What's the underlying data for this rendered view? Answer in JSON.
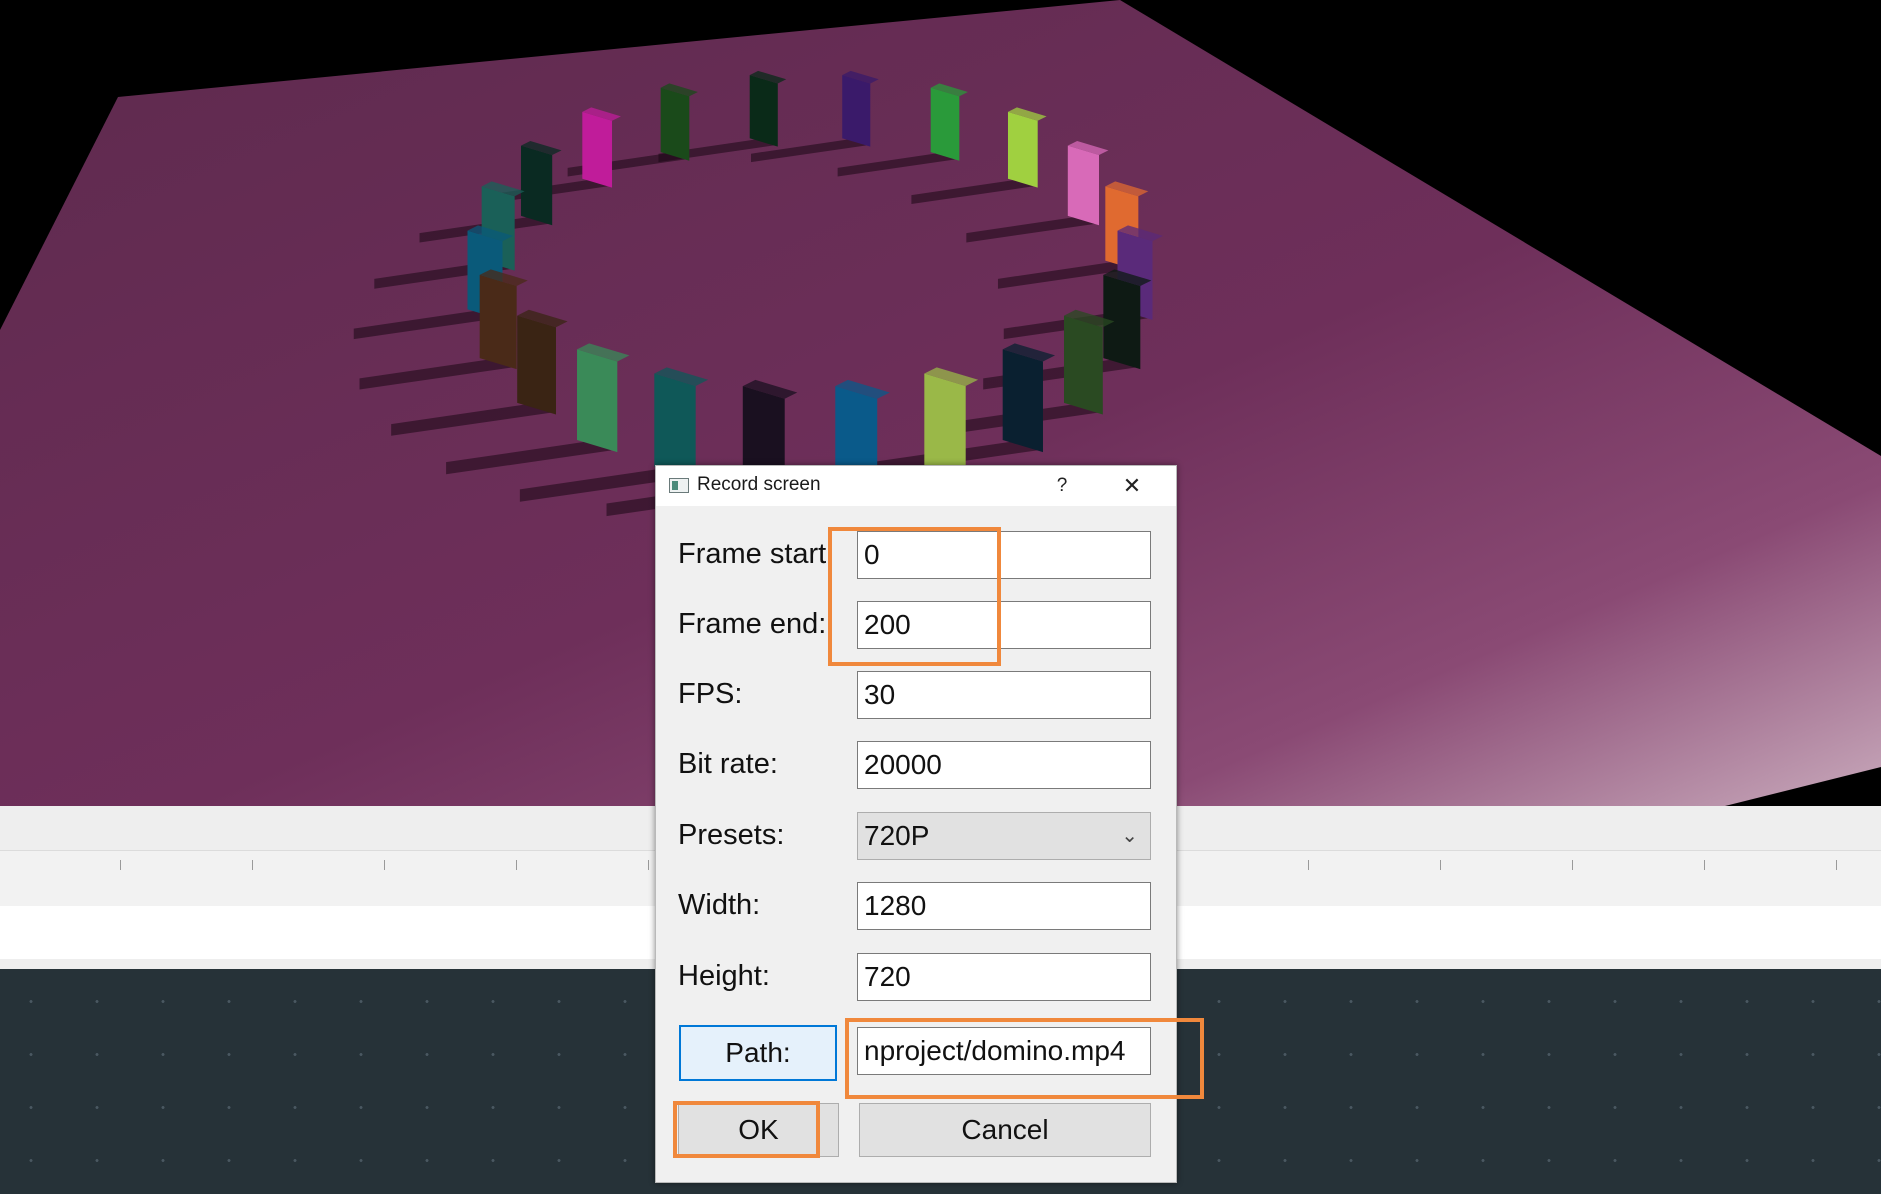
{
  "dialog": {
    "title": "Record screen",
    "help": "?",
    "close": "✕",
    "fields": {
      "frame_start": {
        "label": "Frame start",
        "value": "0"
      },
      "frame_end": {
        "label": "Frame end:",
        "value": "200"
      },
      "fps": {
        "label": "FPS:",
        "value": "30"
      },
      "bit_rate": {
        "label": "Bit rate:",
        "value": "20000"
      },
      "presets": {
        "label": "Presets:",
        "value": "720P"
      },
      "width": {
        "label": "Width:",
        "value": "1280"
      },
      "height": {
        "label": "Height:",
        "value": "720"
      }
    },
    "path": {
      "button": "Path:",
      "value": "nproject/domino.mp4"
    },
    "ok": "OK",
    "cancel": "Cancel"
  },
  "colors": {
    "highlight": "#f0883c",
    "floor": "#6c2d57",
    "bottom_panel": "#263238"
  },
  "icons": [
    "app-window-icon",
    "help-icon",
    "close-icon",
    "chevron-down-icon"
  ]
}
